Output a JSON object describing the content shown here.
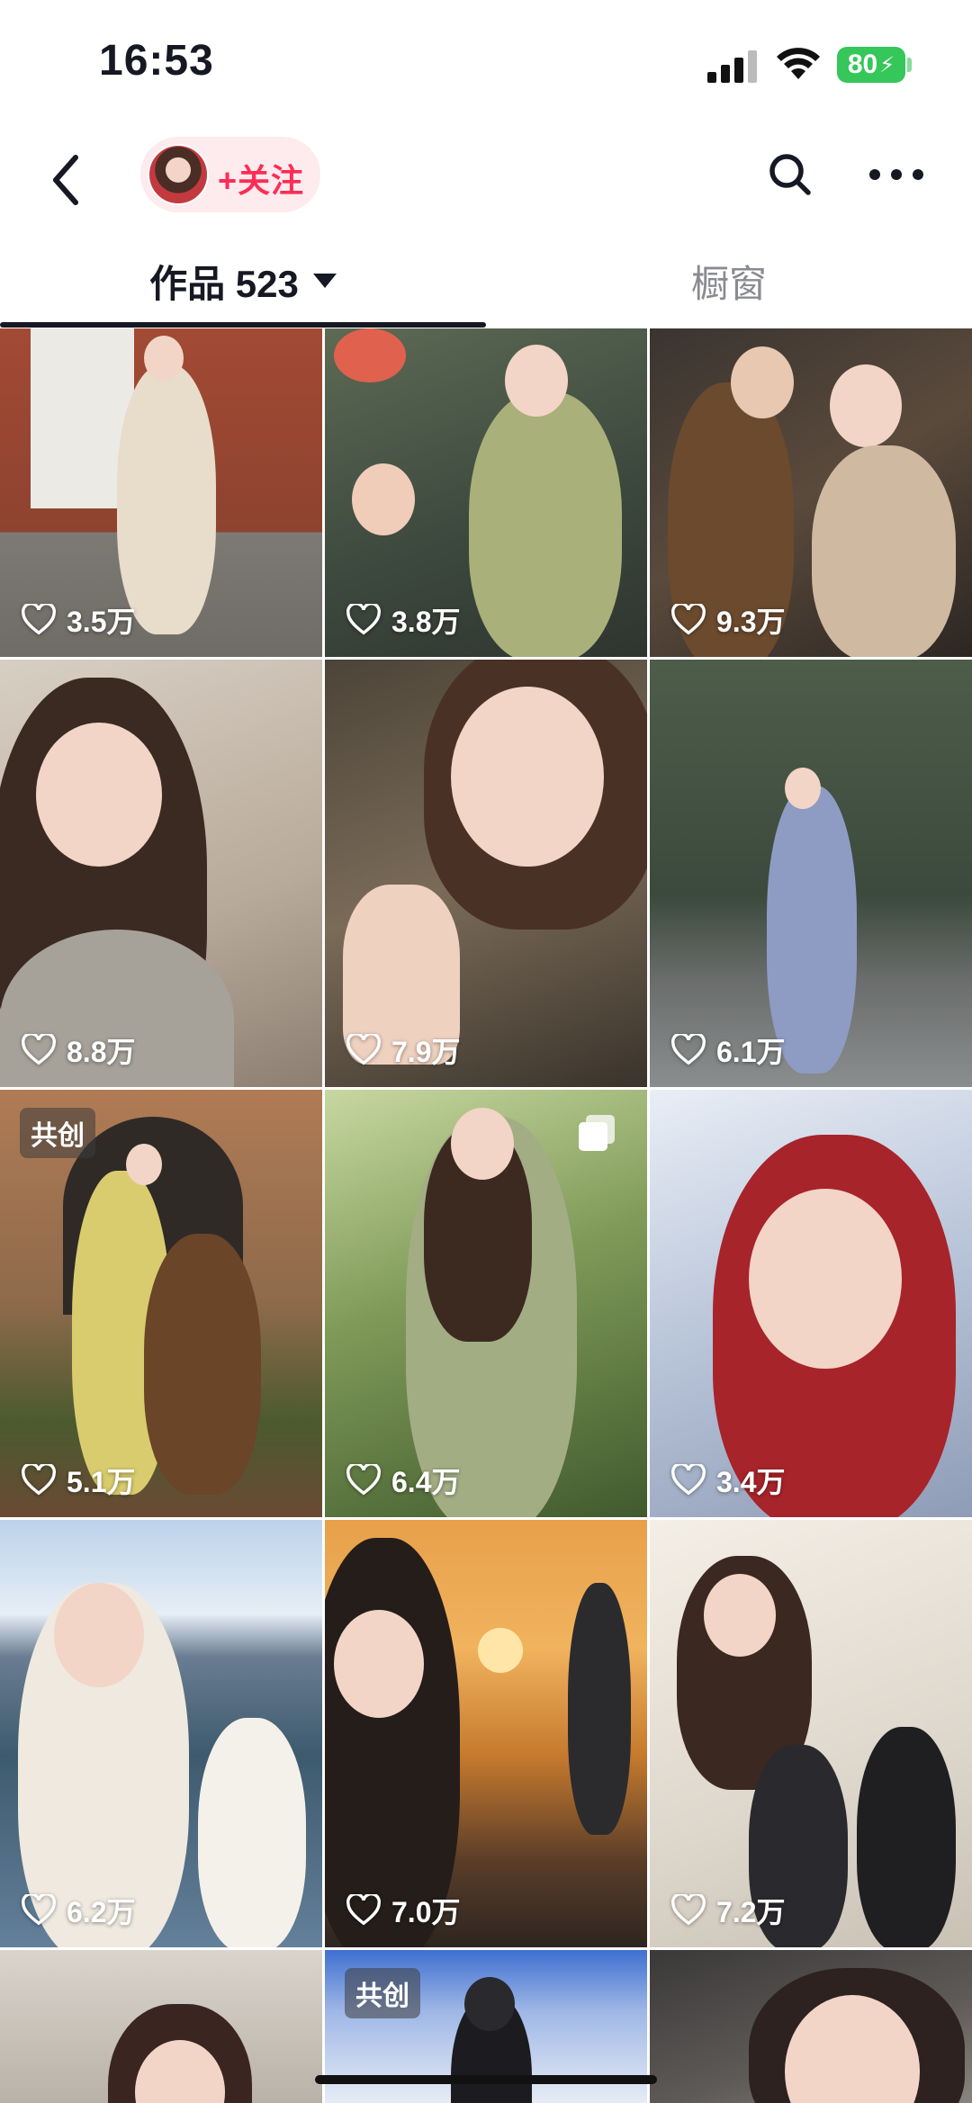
{
  "status_bar": {
    "time": "16:53",
    "battery": "80"
  },
  "nav": {
    "follow_label": "+关注"
  },
  "tabs": {
    "works_label": "作品 523",
    "showcase_label": "橱窗"
  },
  "grid": {
    "tiles": [
      {
        "likes": "3.5万"
      },
      {
        "likes": "3.8万"
      },
      {
        "likes": "9.3万"
      },
      {
        "likes": "8.8万"
      },
      {
        "likes": "7.9万"
      },
      {
        "likes": "6.1万"
      },
      {
        "likes": "5.1万",
        "badge": "共创"
      },
      {
        "likes": "6.4万"
      },
      {
        "likes": "3.4万"
      },
      {
        "likes": "6.2万"
      },
      {
        "likes": "7.0万"
      },
      {
        "likes": "7.2万"
      },
      {
        "likes": ""
      },
      {
        "likes": "",
        "badge": "共创"
      },
      {
        "likes": ""
      }
    ]
  },
  "colors": {
    "accent": "#fe2c55",
    "battery": "#35c759",
    "text": "#161823"
  }
}
